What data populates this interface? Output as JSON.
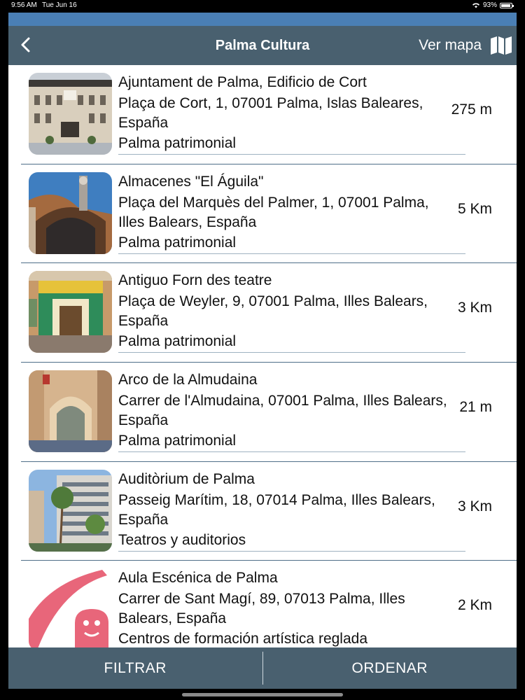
{
  "status": {
    "time": "9:56 AM",
    "date": "Tue Jun 16",
    "battery": "93%"
  },
  "header": {
    "title": "Palma Cultura",
    "map_label": "Ver mapa"
  },
  "items": [
    {
      "name": "Ajuntament de Palma, Edificio de Cort",
      "address": "Plaça de Cort, 1, 07001 Palma, Islas Baleares, España",
      "category": "Palma patrimonial",
      "distance": "275 m"
    },
    {
      "name": "Almacenes \"El Águila\"",
      "address": "Plaça del Marquès del Palmer, 1, 07001 Palma, Illes Balears, España",
      "category": "Palma patrimonial",
      "distance": "5 Km"
    },
    {
      "name": "Antiguo Forn des teatre",
      "address": "Plaça de Weyler, 9, 07001 Palma, Illes Balears, España",
      "category": "Palma patrimonial",
      "distance": "3 Km"
    },
    {
      "name": "Arco de la Almudaina",
      "address": "Carrer de l'Almudaina, 07001 Palma, Illes Balears, España",
      "category": "Palma patrimonial",
      "distance": "21 m"
    },
    {
      "name": "Auditòrium de Palma",
      "address": "Passeig Marítim, 18, 07014 Palma, Illes Balears, España",
      "category": "Teatros y auditorios",
      "distance": "3 Km"
    },
    {
      "name": "Aula Escénica de Palma",
      "address": "Carrer de Sant Magí, 89, 07013 Palma, Illes Balears, España",
      "category": "Centros de formación artística reglada",
      "distance": "2 Km"
    }
  ],
  "footer": {
    "filter_label": "FILTRAR",
    "sort_label": "ORDENAR"
  },
  "colors": {
    "nav": "#49606f",
    "accent": "#4a7fb5",
    "separator": "#4e6e88"
  }
}
